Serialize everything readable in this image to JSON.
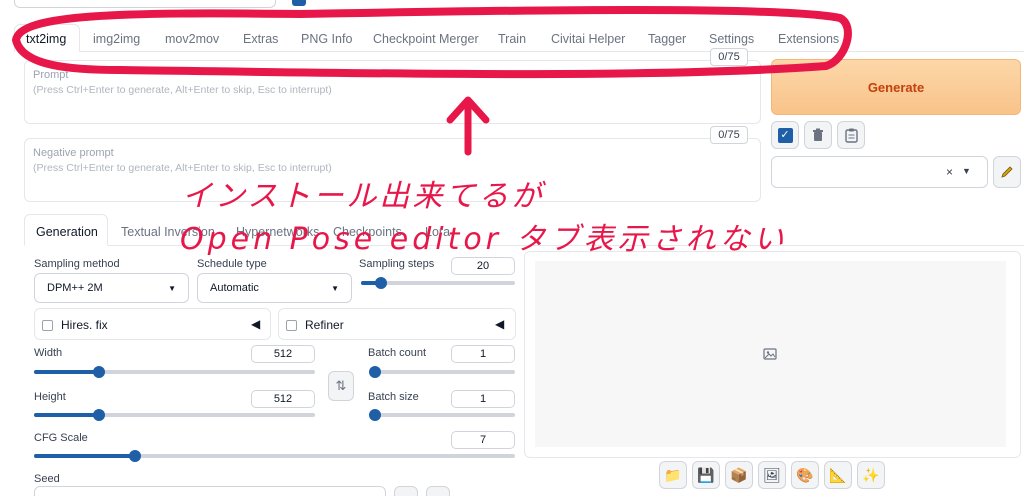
{
  "tabs": [
    "txt2img",
    "img2img",
    "mov2mov",
    "Extras",
    "PNG Info",
    "Checkpoint Merger",
    "Train",
    "Civitai Helper",
    "Tagger",
    "Settings",
    "Extensions"
  ],
  "prompt": {
    "label": "Prompt",
    "placeholder": "(Press Ctrl+Enter to generate, Alt+Enter to skip, Esc to interrupt)",
    "counter": "0/75"
  },
  "negative_prompt": {
    "label": "Negative prompt",
    "placeholder": "(Press Ctrl+Enter to generate, Alt+Enter to skip, Esc to interrupt)",
    "counter": "0/75"
  },
  "generate_label": "Generate",
  "subtabs": {
    "generation": "Generation",
    "textual_inversion": "Textual Inversion",
    "hypernetworks": "Hypernetworks",
    "checkpoints": "Checkpoints",
    "lora": "Lora"
  },
  "settings": {
    "sampling_method_label": "Sampling method",
    "sampling_method_value": "DPM++ 2M",
    "schedule_type_label": "Schedule type",
    "schedule_type_value": "Automatic",
    "sampling_steps_label": "Sampling steps",
    "sampling_steps_value": "20",
    "hires_label": "Hires. fix",
    "refiner_label": "Refiner",
    "width_label": "Width",
    "width_value": "512",
    "height_label": "Height",
    "height_value": "512",
    "batch_count_label": "Batch count",
    "batch_count_value": "1",
    "batch_size_label": "Batch size",
    "batch_size_value": "1",
    "cfg_label": "CFG Scale",
    "cfg_value": "7",
    "seed_label": "Seed",
    "fractions": {
      "sampling_steps": 0.13,
      "width": 0.23,
      "height": 0.23,
      "batch_count": 0.0,
      "batch_size": 0.0,
      "cfg": 0.21
    }
  },
  "annotation": {
    "line1": "インストール出来てるが",
    "line2": "Open Pose editor タブ表示されない"
  },
  "colors": {
    "accent": "#1e5fa8",
    "generate": "#f9c38a",
    "annotation": "#e8174a"
  },
  "icons": {
    "swap_icon": "⇅",
    "output_buttons": [
      "folder-icon",
      "save-icon",
      "zip-icon",
      "image-icon",
      "palette-icon",
      "ruler-icon",
      "sparkle-icon"
    ]
  }
}
